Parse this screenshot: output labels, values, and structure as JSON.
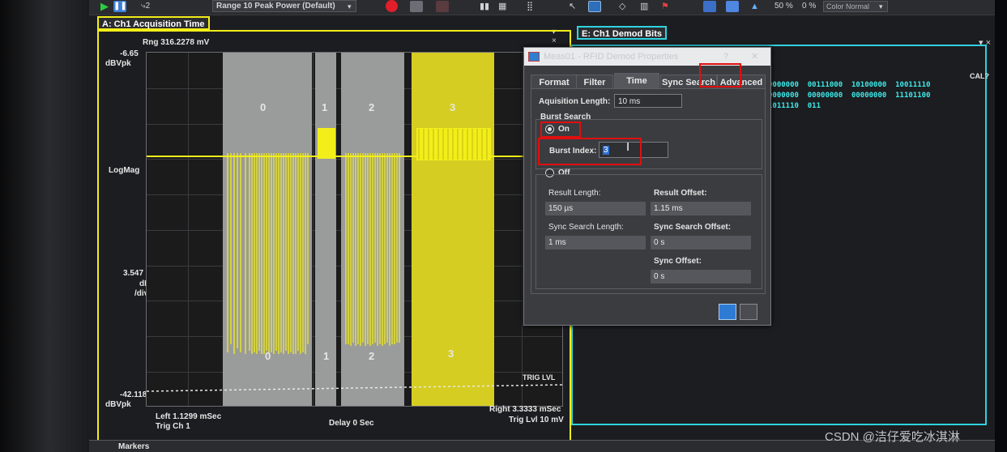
{
  "toolbar": {
    "range_label": "Range 10 Peak Power (Default)",
    "zoom_pct": "50 %",
    "offset_pct": "0 %",
    "color_mode": "Color Normal"
  },
  "trace_a": {
    "tab": "A: Ch1 Acquisition Time",
    "range": "Rng 316.2278 mV",
    "top_value": "-6.65",
    "top_unit": "dBVpk",
    "format": "LogMag",
    "scale_value": "3.547",
    "scale_unit1": "dB",
    "scale_unit2": "/div",
    "bottom_value": "-42.118",
    "bottom_unit": "dBVpk",
    "left_axis": "Left 1.1299 mSec",
    "trig_ch": "Trig Ch 1",
    "delay": "Delay 0  Sec",
    "right_axis": "Right 3.3333 mSec",
    "trig_lvl": "Trig Lvl 10 mV",
    "trig_marker": "TRIG LVL",
    "burst_labels": [
      "0",
      "1",
      "2",
      "3"
    ]
  },
  "trace_e": {
    "tab": "E: Ch1 Demod Bits",
    "cal": "CAL?",
    "bit_lines": [
      "0000000  00111000  10100000  10011110",
      "0000000  00000000  00000000  11101100",
      "1011110  011"
    ]
  },
  "dialog": {
    "title": "Meas01 - RFID Demod Properties",
    "tabs": [
      "Format",
      "Filter",
      "Time",
      "Sync Search",
      "Advanced"
    ],
    "acq_label": "Aquisition Length:",
    "acq_value": "10 ms",
    "burst_group": "Burst Search",
    "on_label": "On",
    "burst_index_label": "Burst Index:",
    "burst_index_value": "3",
    "off_label": "Off",
    "result_length_label": "Result Length:",
    "result_length_value": "150 µs",
    "result_offset_label": "Result Offset:",
    "result_offset_value": "1.15 ms",
    "sync_len_label": "Sync Search Length:",
    "sync_len_value": "1 ms",
    "sync_off_label": "Sync Search Offset:",
    "sync_off_value": "0 s",
    "sync_offset_label": "Sync Offset:",
    "sync_offset_value": "0 s"
  },
  "footer": {
    "markers": "Markers"
  },
  "watermark": "CSDN @洁仔爱吃冰淇淋",
  "colors": {
    "trace": "#f2ee1a",
    "highlight_burst": "#d9cf1d",
    "cyan": "#2fd3e0",
    "red_box": "#e10f0f"
  }
}
